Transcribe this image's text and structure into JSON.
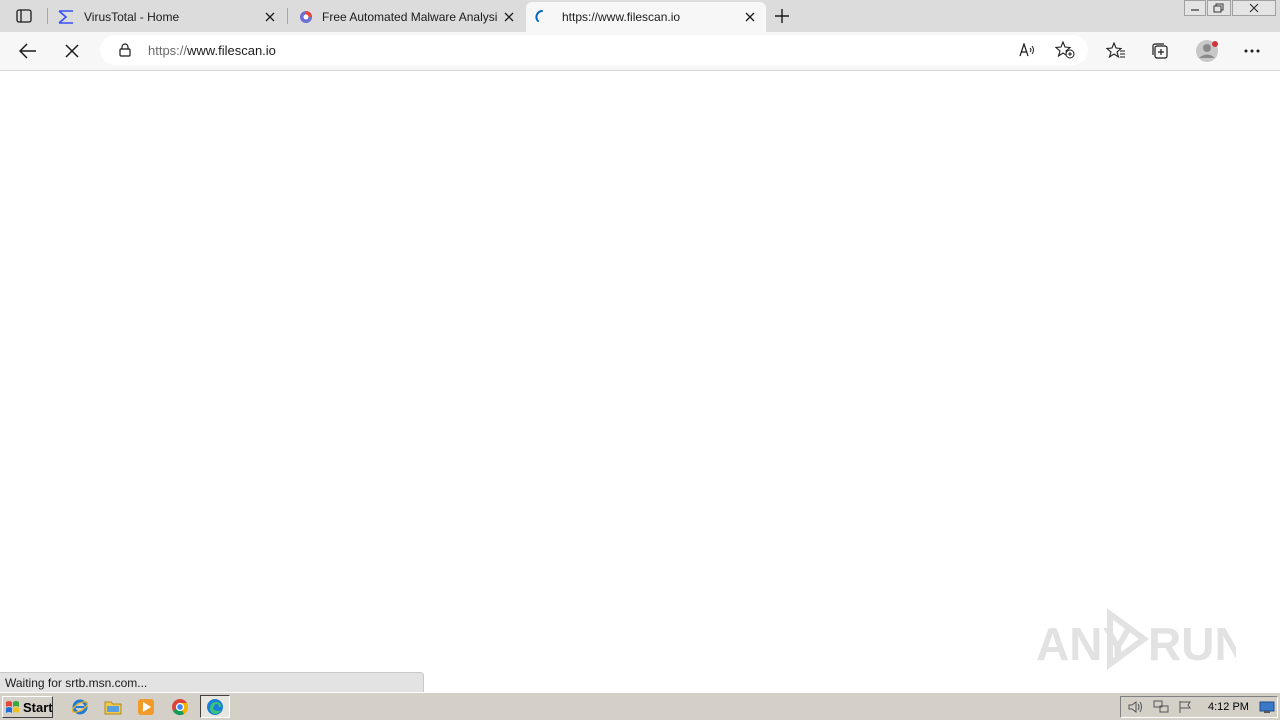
{
  "browser": {
    "tabs": [
      {
        "title": "VirusTotal - Home",
        "icon": "virustotal-icon",
        "active": false
      },
      {
        "title": "Free Automated Malware Analysi",
        "icon": "hybrid-analysis-icon",
        "active": false
      },
      {
        "title": "https://www.filescan.io",
        "icon": "loading-spinner-icon",
        "active": true
      }
    ],
    "address": {
      "prefix": "https://",
      "host": "www.filescan.io"
    },
    "status_text": "Waiting for srtb.msn.com..."
  },
  "taskbar": {
    "start_label": "Start",
    "clock": "4:12 PM",
    "apps": [
      "ie-icon",
      "explorer-icon",
      "media-player-icon",
      "chrome-icon",
      "edge-icon"
    ]
  },
  "watermark": {
    "left": "ANY",
    "right": "RUN"
  },
  "colors": {
    "accent": "#0067c0",
    "watermark": "#e2e2e2"
  }
}
